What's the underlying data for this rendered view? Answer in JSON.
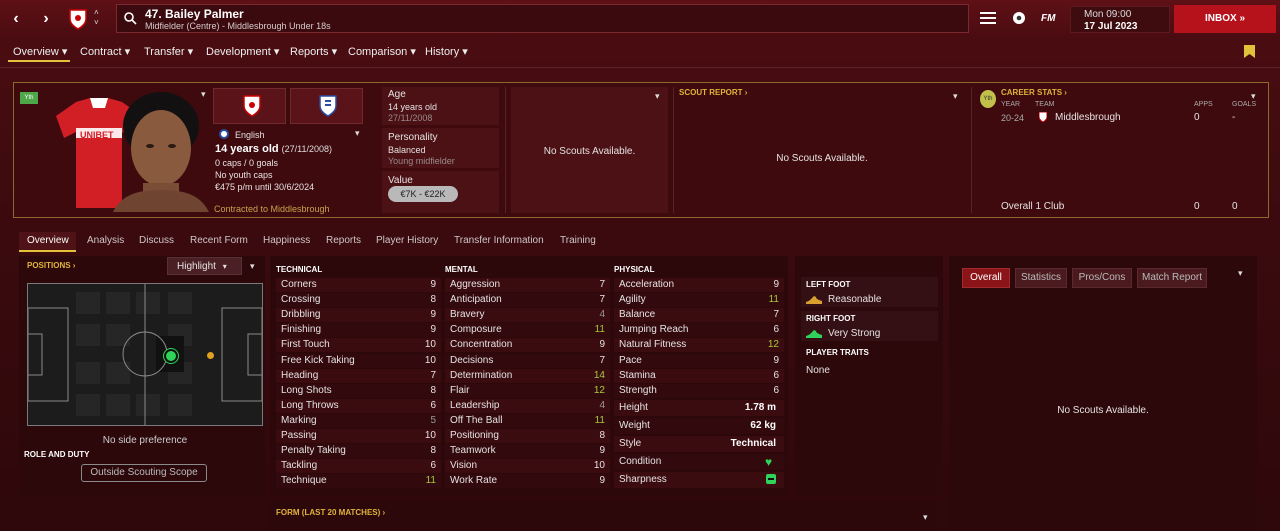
{
  "header": {
    "player_title": "47. Bailey Palmer",
    "player_subtitle": "Midfielder (Centre) - Middlesbrough Under 18s",
    "date_day": "Mon 09:00",
    "date_full": "17 Jul 2023",
    "inbox": "INBOX",
    "fm_logo": "FM"
  },
  "menu": [
    "Overview",
    "Contract",
    "Transfer",
    "Development",
    "Reports",
    "Comparison",
    "History"
  ],
  "profile": {
    "youth_badge": "Yth",
    "nationality": "English",
    "age_line": "14 years old",
    "dob": "(27/11/2008)",
    "caps": "0 caps / 0 goals",
    "youth_caps": "No youth caps",
    "wage": "€475 p/m until 30/6/2024",
    "contracted": "Contracted to Middlesbrough",
    "shirt_text": "UNIBET"
  },
  "info": {
    "age_label": "Age",
    "age_value": "14 years old",
    "age_date": "27/11/2008",
    "personality_label": "Personality",
    "personality_value": "Balanced",
    "personality_sub": "Young midfielder",
    "value_label": "Value",
    "value_range": "€7K - €22K"
  },
  "scouting": {
    "no_scouts_1": "No Scouts Available.",
    "report_label": "SCOUT REPORT",
    "no_scouts_2": "No Scouts Available.",
    "no_scouts_3": "No Scouts Available."
  },
  "career": {
    "label": "CAREER STATS",
    "badge": "Yth",
    "col_year": "YEAR",
    "col_team": "TEAM",
    "col_apps": "APPS",
    "col_goals": "GOALS",
    "year": "20-24",
    "team": "Middlesbrough",
    "apps": "0",
    "goals": "-",
    "overall_label": "Overall 1 Club",
    "overall_apps": "0",
    "overall_goals": "0"
  },
  "subtabs": [
    "Overview",
    "Analysis",
    "Discuss",
    "Recent Form",
    "Happiness",
    "Reports",
    "Player History",
    "Transfer Information",
    "Training"
  ],
  "positions": {
    "label": "POSITIONS",
    "highlight": "Highlight",
    "side_pref": "No side preference",
    "role_label": "ROLE AND DUTY",
    "role_button": "Outside Scouting Scope"
  },
  "attributes": {
    "technical_label": "TECHNICAL",
    "mental_label": "MENTAL",
    "physical_label": "PHYSICAL",
    "technical": [
      [
        "Corners",
        "9"
      ],
      [
        "Crossing",
        "8"
      ],
      [
        "Dribbling",
        "9"
      ],
      [
        "Finishing",
        "9"
      ],
      [
        "First Touch",
        "10"
      ],
      [
        "Free Kick Taking",
        "10"
      ],
      [
        "Heading",
        "7"
      ],
      [
        "Long Shots",
        "8"
      ],
      [
        "Long Throws",
        "6"
      ],
      [
        "Marking",
        "5"
      ],
      [
        "Passing",
        "10"
      ],
      [
        "Penalty Taking",
        "8"
      ],
      [
        "Tackling",
        "6"
      ],
      [
        "Technique",
        "11"
      ]
    ],
    "mental": [
      [
        "Aggression",
        "7"
      ],
      [
        "Anticipation",
        "7"
      ],
      [
        "Bravery",
        "4"
      ],
      [
        "Composure",
        "11"
      ],
      [
        "Concentration",
        "9"
      ],
      [
        "Decisions",
        "7"
      ],
      [
        "Determination",
        "14"
      ],
      [
        "Flair",
        "12"
      ],
      [
        "Leadership",
        "4"
      ],
      [
        "Off The Ball",
        "11"
      ],
      [
        "Positioning",
        "8"
      ],
      [
        "Teamwork",
        "9"
      ],
      [
        "Vision",
        "10"
      ],
      [
        "Work Rate",
        "9"
      ]
    ],
    "physical": [
      [
        "Acceleration",
        "9"
      ],
      [
        "Agility",
        "11"
      ],
      [
        "Balance",
        "7"
      ],
      [
        "Jumping Reach",
        "6"
      ],
      [
        "Natural Fitness",
        "12"
      ],
      [
        "Pace",
        "9"
      ],
      [
        "Stamina",
        "6"
      ],
      [
        "Strength",
        "6"
      ]
    ],
    "extra": [
      [
        "Height",
        "1.78 m"
      ],
      [
        "Weight",
        "62 kg"
      ],
      [
        "Style",
        "Technical"
      ],
      [
        "Condition",
        ""
      ],
      [
        "Sharpness",
        ""
      ]
    ]
  },
  "feet": {
    "left_label": "LEFT FOOT",
    "left_value": "Reasonable",
    "right_label": "RIGHT FOOT",
    "right_value": "Very Strong",
    "traits_label": "PLAYER TRAITS",
    "traits_value": "None"
  },
  "right_tabs": [
    "Overall",
    "Statistics",
    "Pros/Cons",
    "Match Report"
  ],
  "form_label": "FORM (LAST 20 MATCHES)",
  "colors": {
    "high": "#a8c83a",
    "mid": "#e6e2e2",
    "low": "#9a9a9a",
    "accent": "#e1c23a",
    "inbox": "#b5121b"
  }
}
